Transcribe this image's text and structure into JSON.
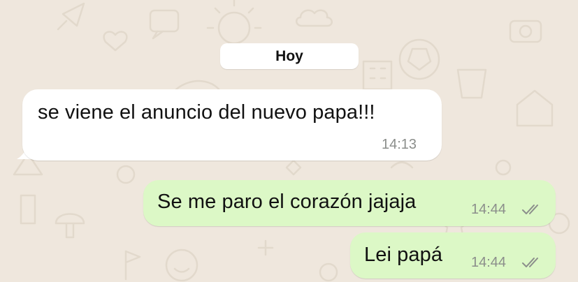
{
  "chat": {
    "date_label": "Hoy",
    "messages": [
      {
        "direction": "incoming",
        "text": "se viene el anuncio del nuevo papa!!!",
        "time": "14:13"
      },
      {
        "direction": "outgoing",
        "text": "Se me paro el corazón jajaja",
        "time": "14:44",
        "status_icon": "double-check-icon"
      },
      {
        "direction": "outgoing",
        "text": "Lei papá",
        "time": "14:44",
        "status_icon": "double-check-icon"
      }
    ]
  },
  "colors": {
    "background": "#efe7dd",
    "incoming_bubble": "#ffffff",
    "outgoing_bubble": "#dcf8c6",
    "timestamp": "#8b8e8b"
  }
}
